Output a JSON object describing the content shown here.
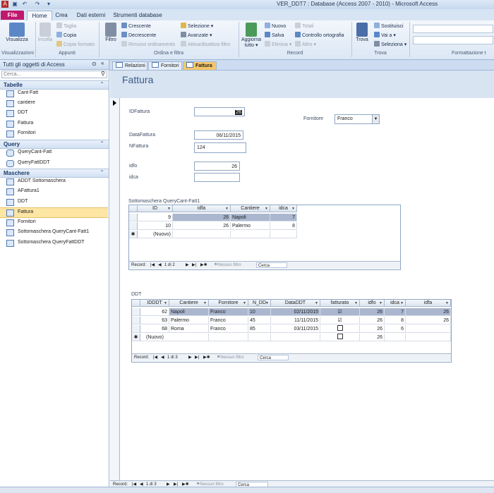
{
  "window": {
    "title": "VER_DDT7 : Database (Access 2007 - 2010) - Microsoft Access"
  },
  "ribbon_tabs": [
    "File",
    "Home",
    "Crea",
    "Dati esterni",
    "Strumenti database"
  ],
  "ribbon": {
    "visualizza": "Visualizza",
    "incolla": "Incolla",
    "taglia": "Taglia",
    "copia": "Copia",
    "copia_formato": "Copia formato",
    "filtro": "Filtro",
    "crescente": "Crescente",
    "decrescente": "Decrescente",
    "rimuovi_ordinamento": "Rimuovi ordinamento",
    "selezione": "Selezione",
    "avanzate": "Avanzate",
    "attiva_filtro": "Attiva/disattiva filtro",
    "aggiorna": "Aggiorna tutto",
    "nuovo": "Nuovo",
    "salva": "Salva",
    "elimina": "Elimina",
    "totali": "Totali",
    "controllo": "Controllo ortografia",
    "altro": "Altro",
    "trova": "Trova",
    "sostituisci": "Sostituisci",
    "vai_a": "Vai a",
    "seleziona": "Seleziona",
    "groups": [
      "Visualizzazioni",
      "Appunti",
      "Ordina e filtra",
      "Record",
      "Trova",
      "Formattazione t"
    ]
  },
  "nav": {
    "header": "Tutti gli oggetti di Access",
    "search_placeholder": "Cerca...",
    "groups": [
      {
        "name": "Tabelle",
        "items": [
          "Cant-Fatt",
          "cantiere",
          "DDT",
          "Fattura",
          "Fornitori"
        ]
      },
      {
        "name": "Query",
        "items": [
          "QueryCant-Fatt",
          "QueryFattDDT"
        ]
      },
      {
        "name": "Maschere",
        "items": [
          "ADDT Sottomaschera",
          "AFattura1",
          "DDT",
          "Fattura",
          "Fornitori",
          "Sottomaschera QueryCant-Fatt1",
          "Sottomaschera QueryFattDDT"
        ]
      }
    ]
  },
  "doc_tabs": [
    "Relazioni",
    "Fornitori",
    "Fattura"
  ],
  "form": {
    "title": "Fattura",
    "idfattura_label": "IDFattura",
    "idfattura": "26",
    "fornitore_label": "Fornitore",
    "fornitore": "Franco",
    "datafattura_label": "DataFattura",
    "datafattura": "06/11/2015",
    "nfattura_label": "NFattura",
    "nfattura": "124",
    "idfo_label": "idfo",
    "idfo": "26",
    "idca_label": "idca",
    "idca": ""
  },
  "sub1": {
    "caption": "Sottomaschera QueryCant-Fatt1",
    "headers": [
      "ID",
      "idfa",
      "Cantiere",
      "idca"
    ],
    "rows": [
      [
        "9",
        "26",
        "Napoli",
        "7"
      ],
      [
        "10",
        "26",
        "Palermo",
        "8"
      ]
    ],
    "new_row": "(Nuovo)",
    "nav_label": "Record:",
    "nav_pos": "1 di 2",
    "nav_filter": "Nessun filtro",
    "nav_search": "Cerca"
  },
  "sub2": {
    "caption": "DDT",
    "headers": [
      "IDDDT",
      "Cantiere",
      "Fornitore",
      "N_DD",
      "DataDDT",
      "fatturato",
      "idfo",
      "idca",
      "idfa"
    ],
    "rows": [
      [
        "62",
        "Napoli",
        "Franco",
        "10",
        "02/11/2015",
        "☑",
        "26",
        "7",
        "26"
      ],
      [
        "63",
        "Palermo",
        "Franco",
        "45",
        "11/11/2015",
        "☑",
        "26",
        "8",
        "26"
      ],
      [
        "68",
        "Roma",
        "Franco",
        "85",
        "03/11/2015",
        "",
        "26",
        "6",
        ""
      ]
    ],
    "new_row": "(Nuovo)",
    "new_idfo": "26",
    "nav_label": "Record:",
    "nav_pos": "1 di 3",
    "nav_filter": "Nessun filtro",
    "nav_search": "Cerca"
  },
  "main_nav": {
    "label": "Record:",
    "pos": "1 di 3",
    "filter": "Nessun filtro",
    "search": "Cerca"
  },
  "colors": {
    "file_tab": "#c0186e",
    "selected_row": "#aab7cf",
    "active_doc_tab": "#f6c66a",
    "form_header": "#d8e4f2"
  }
}
